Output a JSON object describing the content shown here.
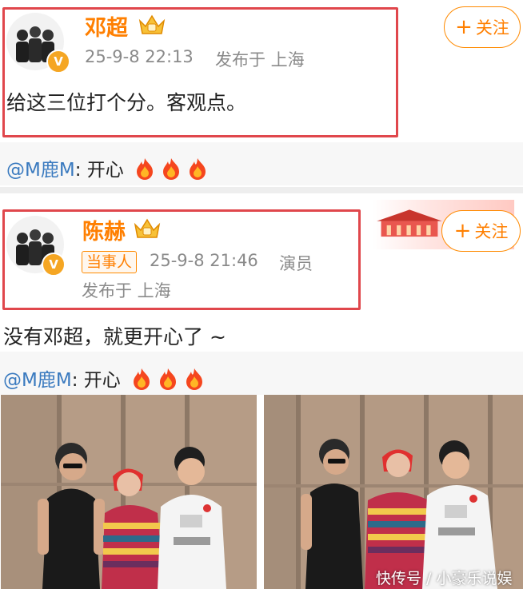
{
  "post1": {
    "author": "邓超",
    "time": "25-9-8 22:13",
    "location": "发布于 上海",
    "text": "给这三位打个分。客观点。",
    "follow_label": "关注",
    "verify_mark": "V"
  },
  "reply1": {
    "user": "@M鹿M",
    "separator": ":",
    "text": "开心"
  },
  "post2": {
    "author": "陈赫",
    "tag": "当事人",
    "time": "25-9-8 21:46",
    "role": "演员",
    "location": "发布于 上海",
    "text": "没有邓超，就更开心了 ~",
    "follow_label": "关注",
    "verify_mark": "V"
  },
  "reply2": {
    "user": "@M鹿M",
    "separator": ":",
    "text": "开心"
  },
  "watermark": "快传号 / 小豪乐说娱",
  "colors": {
    "brand_orange": "#ff7f00",
    "highlight_red": "#e0474c",
    "mention_blue": "#3a7abf"
  }
}
